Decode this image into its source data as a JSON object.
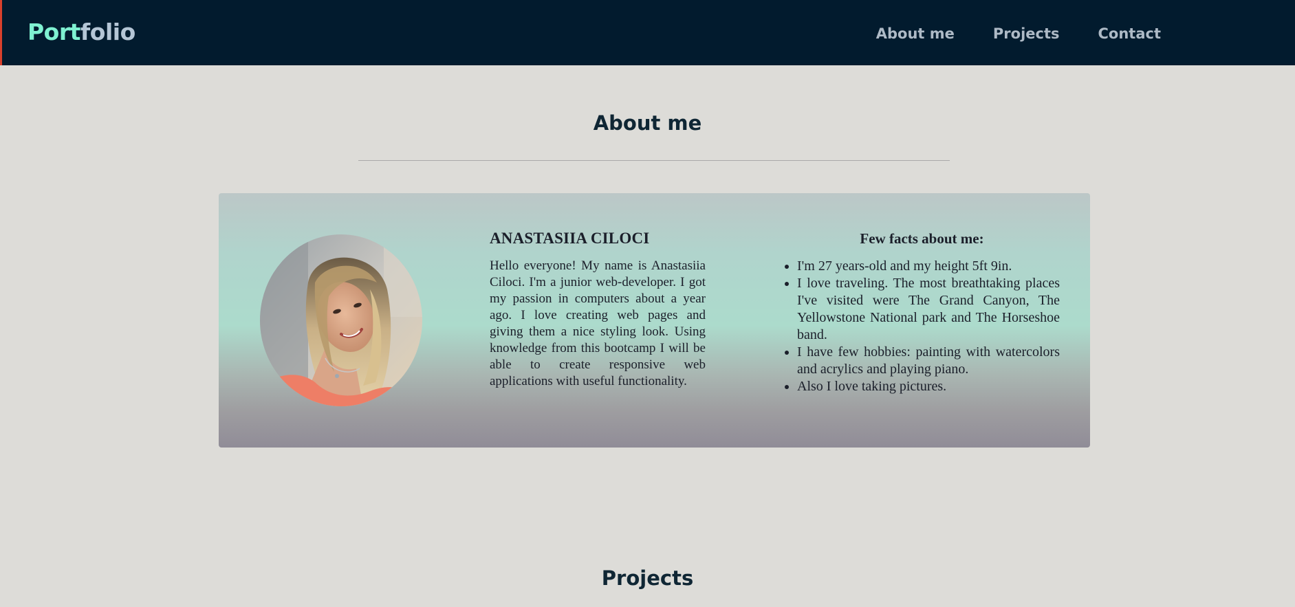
{
  "navbar": {
    "logo": {
      "part1": "Port",
      "part2": "folio"
    },
    "links": [
      "About me",
      "Projects",
      "Contact"
    ],
    "colors": {
      "background": "#021b2e",
      "logo_accent": "#7ff1d1",
      "link": "#aebac6",
      "edge_accent": "#d8402c"
    }
  },
  "about": {
    "title": "About me",
    "profile": {
      "photo_icon": "profile-photo",
      "name": "ANASTASIIA CILOCI",
      "bio": "Hello everyone! My name is Anastasiia Ciloci. I'm a junior web-developer. I got my passion in computers about a year ago. I love creating web pages and giving them a nice styling look. Using knowledge from this bootcamp I will be able to create responsive web applications with useful functionality."
    },
    "facts": {
      "title": "Few facts about me:",
      "items": [
        "I'm 27 years-old and my height 5ft 9in.",
        "I love traveling. The most breathtaking places I've visited were The Grand Canyon, The Yellowstone National park and The Horseshoe band.",
        "I have few hobbies: painting with watercolors and acrylics and playing piano.",
        "Also I love taking pictures."
      ]
    }
  },
  "projects": {
    "title": "Projects"
  }
}
